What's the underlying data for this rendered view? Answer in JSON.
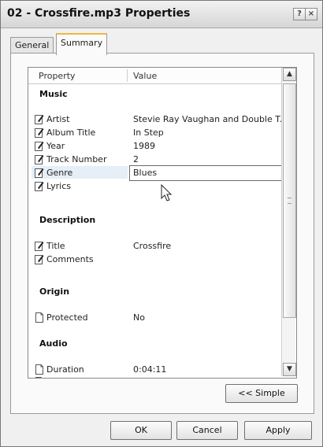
{
  "window": {
    "title": "02 - Crossfire.mp3 Properties"
  },
  "titlebar_buttons": {
    "help": "?",
    "close": "×"
  },
  "tabs": [
    {
      "label": "General"
    },
    {
      "label": "Summary"
    }
  ],
  "columns": {
    "property": "Property",
    "value": "Value"
  },
  "groups": {
    "music": "Music",
    "description": "Description",
    "origin": "Origin",
    "audio": "Audio"
  },
  "rows": {
    "artist": {
      "property": "Artist",
      "value": "Stevie Ray Vaughan and Double T..."
    },
    "album": {
      "property": "Album Title",
      "value": "In Step"
    },
    "year": {
      "property": "Year",
      "value": "1989"
    },
    "track": {
      "property": "Track Number",
      "value": "2"
    },
    "genre": {
      "property": "Genre",
      "value": "Blues"
    },
    "lyrics": {
      "property": "Lyrics",
      "value": ""
    },
    "title": {
      "property": "Title",
      "value": "Crossfire"
    },
    "comments": {
      "property": "Comments",
      "value": ""
    },
    "protected": {
      "property": "Protected",
      "value": "No"
    },
    "duration": {
      "property": "Duration",
      "value": "0:04:11"
    }
  },
  "buttons": {
    "simple": "<< Simple",
    "ok": "OK",
    "cancel": "Cancel",
    "apply": "Apply"
  },
  "colors": {
    "active_tab_accent": "#f0b640",
    "selection": "#e6eef7"
  }
}
